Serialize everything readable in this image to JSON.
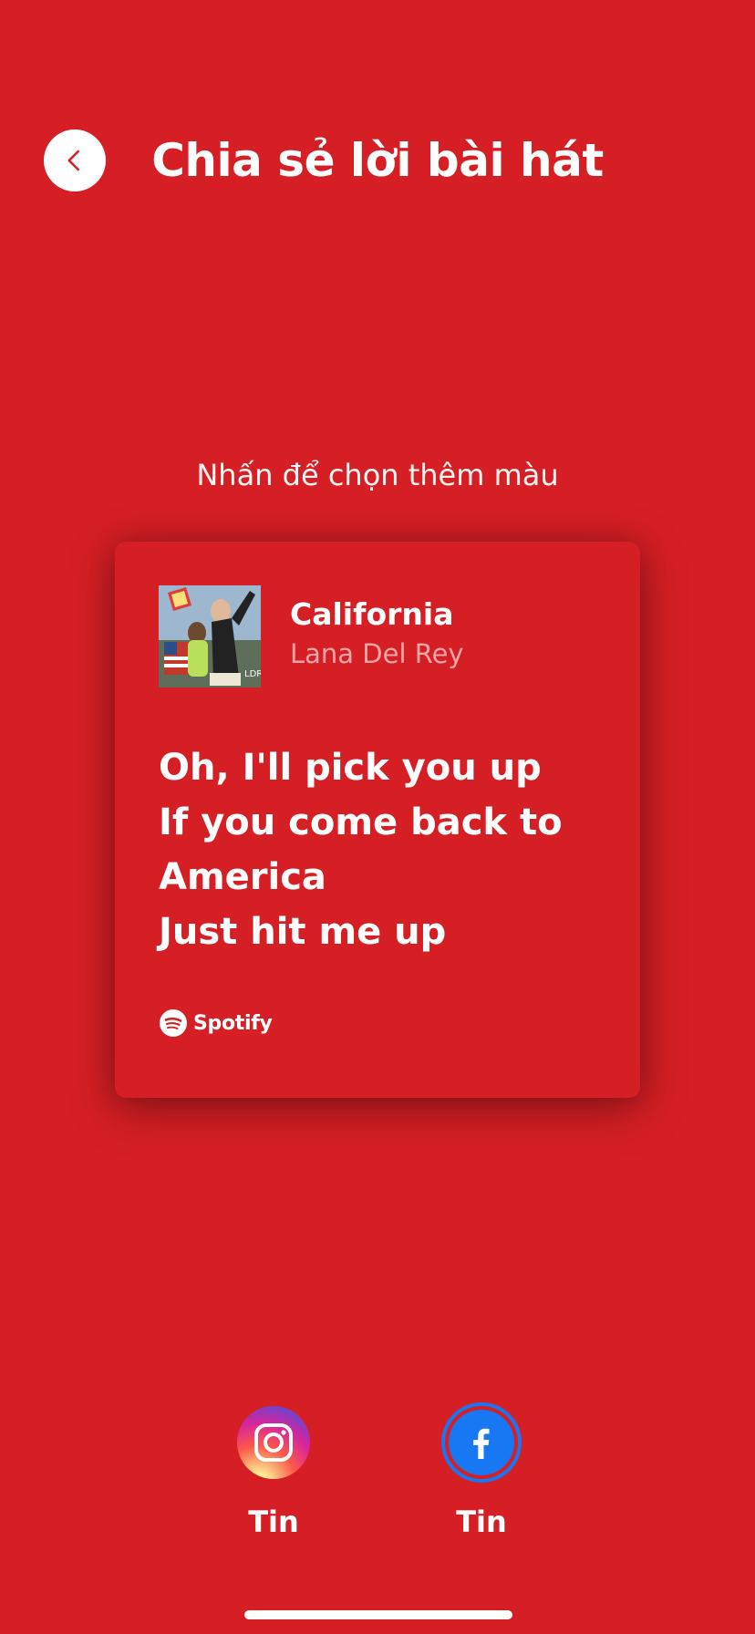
{
  "header": {
    "back_icon": "chevron-left-icon",
    "title": "Chia sẻ lời bài hát"
  },
  "hint": "Nhấn để chọn thêm màu",
  "card": {
    "background_color": "#D61F24",
    "album_art": "album-cover-image",
    "song_title": "California",
    "artist": "Lana Del Rey",
    "lyrics": [
      "Oh, I'll pick you up",
      "If you come back to",
      "America",
      "Just hit me up"
    ],
    "brand_icon": "spotify-icon",
    "brand_name": "Spotify"
  },
  "share": [
    {
      "icon": "instagram-icon",
      "label": "Tin"
    },
    {
      "icon": "facebook-icon",
      "label": "Tin"
    }
  ],
  "colors": {
    "background": "#D61F24",
    "artist_text": "#f5a5a7",
    "facebook": "#1877F2"
  }
}
